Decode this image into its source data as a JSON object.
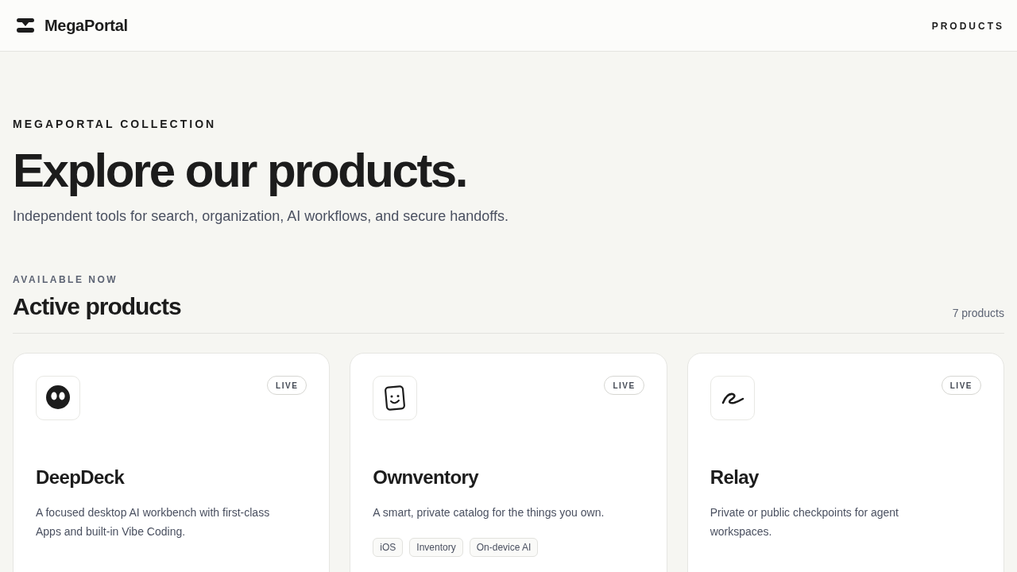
{
  "header": {
    "brand": "MegaPortal",
    "nav": [
      {
        "label": "PRODUCTS"
      }
    ]
  },
  "hero": {
    "eyebrow": "MEGAPORTAL COLLECTION",
    "title": "Explore our products.",
    "subtitle": "Independent tools for search, organization, AI workflows, and secure handoffs."
  },
  "section": {
    "eyebrow": "AVAILABLE NOW",
    "title": "Active products",
    "count": "7 products"
  },
  "products": [
    {
      "name": "DeepDeck",
      "status": "LIVE",
      "description": "A focused desktop AI workbench with first-class Apps and built-in Vibe Coding."
    },
    {
      "name": "Ownventory",
      "status": "LIVE",
      "description": "A smart, private catalog for the things you own.",
      "tags": [
        "iOS",
        "Inventory",
        "On-device AI"
      ]
    },
    {
      "name": "Relay",
      "status": "LIVE",
      "description": "Private or public checkpoints for agent workspaces."
    }
  ]
}
